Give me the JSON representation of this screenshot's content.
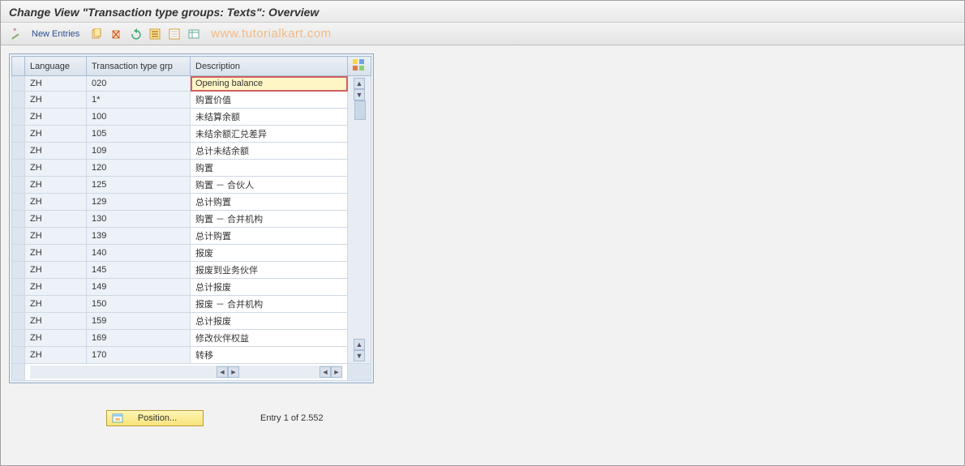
{
  "title": "Change View \"Transaction type groups: Texts\": Overview",
  "toolbar": {
    "new_entries_label": "New Entries"
  },
  "watermark": "www.tutorialkart.com",
  "columns": {
    "language": "Language",
    "grp": "Transaction type grp",
    "desc": "Description"
  },
  "rows": [
    {
      "lang": "ZH",
      "grp": "020",
      "desc": "Opening balance",
      "active": true
    },
    {
      "lang": "ZH",
      "grp": "1*",
      "desc": "购置价值"
    },
    {
      "lang": "ZH",
      "grp": "100",
      "desc": "未结算余额"
    },
    {
      "lang": "ZH",
      "grp": "105",
      "desc": "未结余额汇兑差异"
    },
    {
      "lang": "ZH",
      "grp": "109",
      "desc": "总计未结余额"
    },
    {
      "lang": "ZH",
      "grp": "120",
      "desc": "购置"
    },
    {
      "lang": "ZH",
      "grp": "125",
      "desc": "购置 － 合伙人"
    },
    {
      "lang": "ZH",
      "grp": "129",
      "desc": "总计购置"
    },
    {
      "lang": "ZH",
      "grp": "130",
      "desc": "购置 － 合并机构"
    },
    {
      "lang": "ZH",
      "grp": "139",
      "desc": "总计购置"
    },
    {
      "lang": "ZH",
      "grp": "140",
      "desc": "报废"
    },
    {
      "lang": "ZH",
      "grp": "145",
      "desc": "报废到业务伙伴"
    },
    {
      "lang": "ZH",
      "grp": "149",
      "desc": "总计报废"
    },
    {
      "lang": "ZH",
      "grp": "150",
      "desc": "报废 － 合并机构"
    },
    {
      "lang": "ZH",
      "grp": "159",
      "desc": "总计报废"
    },
    {
      "lang": "ZH",
      "grp": "169",
      "desc": "修改伙伴权益"
    },
    {
      "lang": "ZH",
      "grp": "170",
      "desc": "转移"
    }
  ],
  "footer": {
    "position_label": "Position...",
    "entry_status": "Entry 1 of 2.552"
  }
}
